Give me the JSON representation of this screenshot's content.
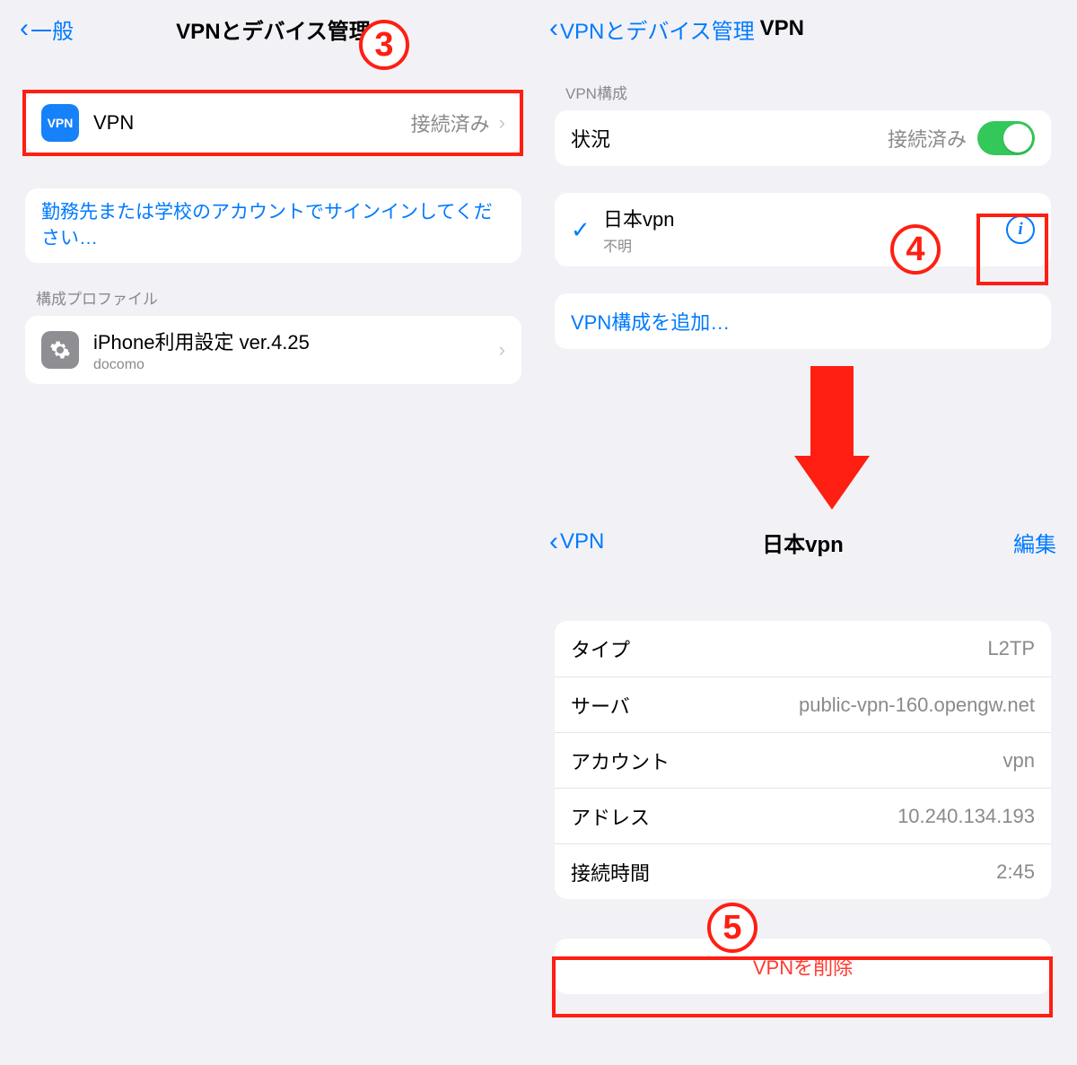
{
  "left": {
    "back_label": "一般",
    "title": "VPNとデバイス管理",
    "vpn_row": {
      "icon_text": "VPN",
      "label": "VPN",
      "status": "接続済み"
    },
    "signin_text": "勤務先または学校のアカウントでサインインしてください…",
    "profiles_header": "構成プロファイル",
    "profile": {
      "title": "iPhone利用設定 ver.4.25",
      "subtitle": "docomo"
    }
  },
  "right": {
    "back_label": "VPNとデバイス管理",
    "title": "VPN",
    "section_header": "VPN構成",
    "status_label": "状況",
    "status_value": "接続済み",
    "vpn_item": {
      "name": "日本vpn",
      "detail": "不明"
    },
    "add_label": "VPN構成を追加…"
  },
  "bottom": {
    "back_label": "VPN",
    "title": "日本vpn",
    "edit_label": "編集",
    "rows": [
      {
        "label": "タイプ",
        "value": "L2TP"
      },
      {
        "label": "サーバ",
        "value": "public-vpn-160.opengw.net"
      },
      {
        "label": "アカウント",
        "value": "vpn"
      },
      {
        "label": "アドレス",
        "value": "10.240.134.193"
      },
      {
        "label": "接続時間",
        "value": "2:45"
      }
    ],
    "delete_label": "VPNを削除"
  },
  "annotations": {
    "n3": "3",
    "n4": "4",
    "n5": "5"
  }
}
